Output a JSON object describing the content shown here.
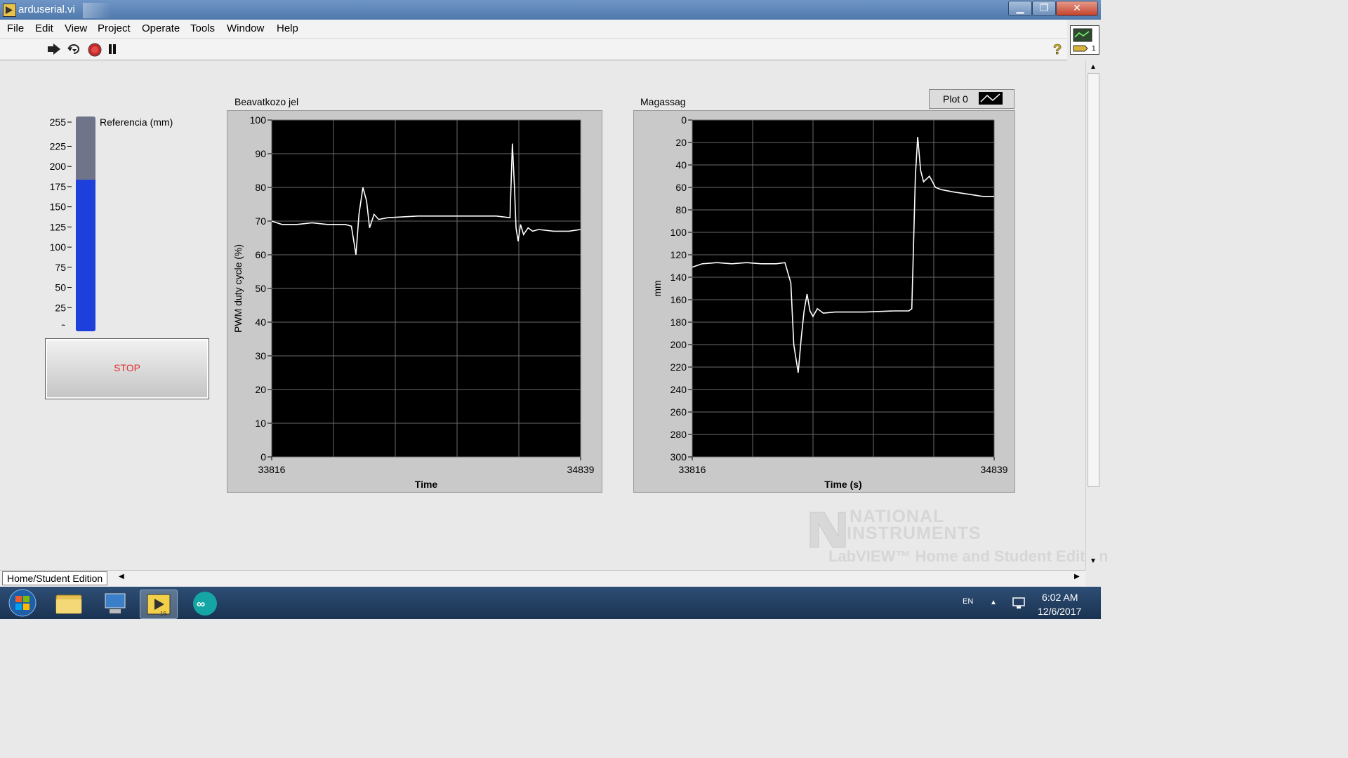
{
  "window": {
    "title": "arduserial.vi",
    "controls": {
      "minimize": "▁",
      "maximize": "❐",
      "close": "✕"
    }
  },
  "menu": [
    "File",
    "Edit",
    "View",
    "Project",
    "Operate",
    "Tools",
    "Window",
    "Help"
  ],
  "toolbar": {
    "run_icon": "run-arrow-icon",
    "run_continuous_icon": "run-continuously-icon",
    "abort_icon": "abort-execution-icon",
    "pause_icon": "pause-icon",
    "help_icon": "context-help-icon"
  },
  "panel": {
    "tank": {
      "label": "Referencia (mm)",
      "scale": [
        "255",
        "225",
        "200",
        "175",
        "150",
        "125",
        "100",
        "75",
        "50",
        "25",
        "0"
      ],
      "value": 180,
      "max": 255,
      "fill_color": "#1d3fdc",
      "empty_color": "#707488"
    },
    "stop_button": {
      "label": "STOP",
      "label_color": "#e03030"
    },
    "plot_legend": {
      "label": "Plot 0"
    }
  },
  "status": {
    "edition": "Home/Student Edition"
  },
  "watermark": {
    "line1": "NATIONAL",
    "line2": "INSTRUMENTS",
    "line3": "LabVIEW™ Home and Student Edition"
  },
  "taskbar": {
    "lang": "EN",
    "time": "6:02 AM",
    "date": "12/6/2017",
    "apps": [
      "start-orb-icon",
      "file-explorer-icon",
      "network-computer-icon",
      "labview-icon",
      "arduino-icon"
    ]
  },
  "chart_data": [
    {
      "type": "line",
      "title": "Beavatkozo jel",
      "xlabel": "Time",
      "ylabel": "PWM duty cycle (%)",
      "xlim": [
        33816,
        34839
      ],
      "ylim": [
        0,
        100
      ],
      "x_ticks": [
        "33816",
        "34839"
      ],
      "y_ticks": [
        "100",
        "90",
        "80",
        "70",
        "60",
        "50",
        "40",
        "30",
        "20",
        "10",
        "0"
      ],
      "grid": true,
      "series": [
        {
          "x": [
            33816,
            33850,
            33900,
            33950,
            34000,
            34060,
            34080,
            34095,
            34105,
            34118,
            34130,
            34140,
            34155,
            34170,
            34200,
            34300,
            34400,
            34500,
            34560,
            34605,
            34613,
            34620,
            34625,
            34632,
            34640,
            34650,
            34665,
            34680,
            34700,
            34750,
            34800,
            34839
          ],
          "y": [
            70,
            69,
            69,
            69.5,
            69,
            69,
            68.5,
            60,
            72,
            80,
            76,
            68,
            72,
            70.5,
            71,
            71.5,
            71.5,
            71.5,
            71.5,
            71,
            93,
            80,
            68,
            64,
            69,
            66,
            68,
            67,
            67.5,
            67,
            67,
            67.5
          ]
        }
      ]
    },
    {
      "type": "line",
      "title": "Magassag",
      "xlabel": "Time (s)",
      "ylabel": "mm",
      "xlim": [
        33816,
        34839
      ],
      "ylim": [
        300,
        0
      ],
      "x_ticks": [
        "33816",
        "34839"
      ],
      "y_ticks": [
        "0",
        "20",
        "40",
        "60",
        "80",
        "100",
        "120",
        "140",
        "160",
        "180",
        "200",
        "220",
        "240",
        "260",
        "280",
        "300"
      ],
      "grid": true,
      "series": [
        {
          "name": "Plot 0",
          "x": [
            33816,
            33850,
            33900,
            33950,
            34000,
            34050,
            34100,
            34130,
            34150,
            34160,
            34175,
            34185,
            34195,
            34205,
            34215,
            34225,
            34240,
            34260,
            34300,
            34400,
            34500,
            34550,
            34560,
            34565,
            34572,
            34580,
            34590,
            34600,
            34620,
            34640,
            34660,
            34700,
            34750,
            34800,
            34839
          ],
          "y": [
            131,
            128,
            127,
            128,
            127,
            128,
            128,
            127,
            145,
            200,
            225,
            195,
            170,
            155,
            170,
            175,
            168,
            172,
            171,
            171,
            170,
            170,
            168,
            120,
            50,
            15,
            45,
            55,
            50,
            60,
            62,
            64,
            66,
            68,
            68
          ]
        }
      ]
    }
  ]
}
